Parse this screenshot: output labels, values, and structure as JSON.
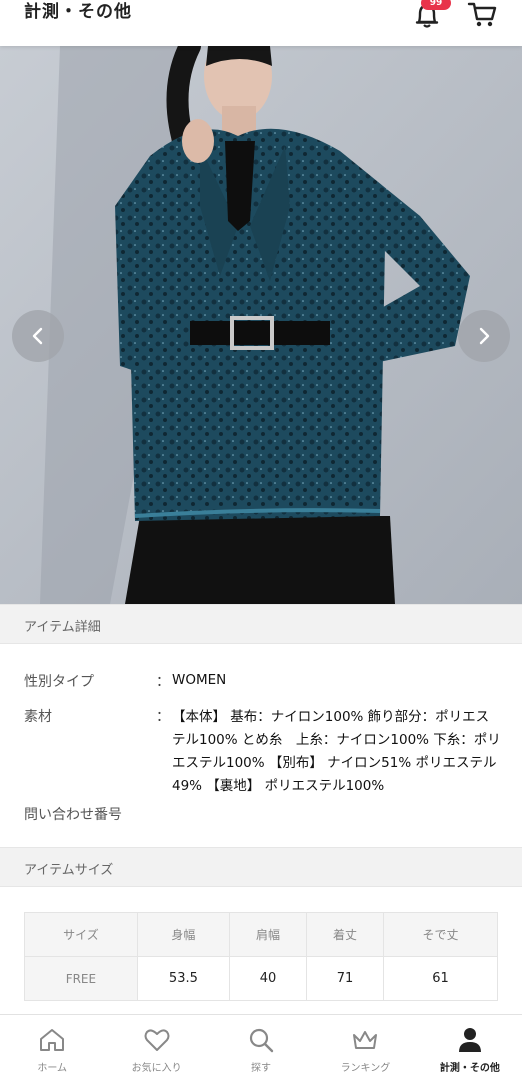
{
  "header": {
    "title": "計測・その他",
    "notification_badge": "99"
  },
  "carousel": {
    "prev_icon": "chevron-left",
    "next_icon": "chevron-right"
  },
  "item_details": {
    "section_title": "アイテム詳細",
    "rows": [
      {
        "label": "性別タイプ",
        "colon": "：",
        "value": "WOMEN"
      },
      {
        "label": "素材",
        "colon": "：",
        "value": "【本体】 基布：ナイロン100% 飾り部分：ポリエステル100% とめ糸　上糸：ナイロン100% 下糸：ポリエステル100% 【別布】 ナイロン51% ポリエステル49% 【裏地】 ポリエステル100%"
      },
      {
        "label": "問い合わせ番号",
        "colon": "",
        "value": ""
      }
    ]
  },
  "item_size": {
    "section_title": "アイテムサイズ",
    "headers": [
      "サイズ",
      "身幅",
      "肩幅",
      "着丈",
      "そで丈"
    ],
    "rows": [
      [
        "FREE",
        "53.5",
        "40",
        "71",
        "61"
      ]
    ]
  },
  "bottom_nav": {
    "items": [
      {
        "label": "ホーム",
        "icon": "home-icon"
      },
      {
        "label": "お気に入り",
        "icon": "heart-icon"
      },
      {
        "label": "探す",
        "icon": "search-icon"
      },
      {
        "label": "ランキング",
        "icon": "crown-icon"
      },
      {
        "label": "計測・その他",
        "icon": "user-icon"
      }
    ]
  },
  "colors": {
    "badge": "#e8334a",
    "garment": "#1d4a5e",
    "background_photo": "#b9bec6"
  }
}
